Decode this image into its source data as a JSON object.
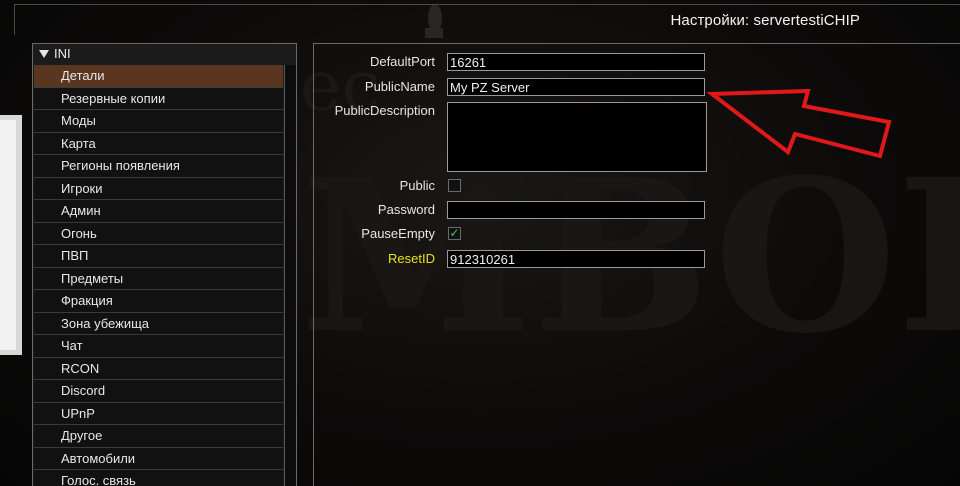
{
  "window": {
    "title": "Настройки: servertestiCHIP"
  },
  "sidebar": {
    "group_label": "INI",
    "items": [
      {
        "label": "Детали",
        "selected": true
      },
      {
        "label": "Резервные копии"
      },
      {
        "label": "Моды"
      },
      {
        "label": "Карта"
      },
      {
        "label": "Регионы появления"
      },
      {
        "label": "Игроки"
      },
      {
        "label": "Админ"
      },
      {
        "label": "Огонь"
      },
      {
        "label": "ПВП"
      },
      {
        "label": "Предметы"
      },
      {
        "label": "Фракция"
      },
      {
        "label": "Зона убежища"
      },
      {
        "label": "Чат"
      },
      {
        "label": "RCON"
      },
      {
        "label": "Discord"
      },
      {
        "label": "UPnP"
      },
      {
        "label": "Другое"
      },
      {
        "label": "Автомобили"
      },
      {
        "label": "Голос. связь"
      }
    ]
  },
  "form": {
    "default_port": {
      "label": "DefaultPort",
      "value": "16261"
    },
    "public_name": {
      "label": "PublicName",
      "value": "My PZ Server"
    },
    "public_description": {
      "label": "PublicDescription",
      "value": ""
    },
    "public": {
      "label": "Public",
      "checked": false
    },
    "password": {
      "label": "Password",
      "value": ""
    },
    "pause_empty": {
      "label": "PauseEmpty",
      "checked": true,
      "check_glyph": "✓"
    },
    "reset_id": {
      "label": "ResetID",
      "value": "912310261"
    }
  },
  "colors": {
    "selected_item": "#5a3520",
    "highlight_label": "#e8e020",
    "checkmark": "#3fcc3f",
    "annotation_arrow": "#e01818"
  },
  "icons": {
    "group_toggle": "triangle-down-icon",
    "annotation": "red-arrow-icon"
  }
}
